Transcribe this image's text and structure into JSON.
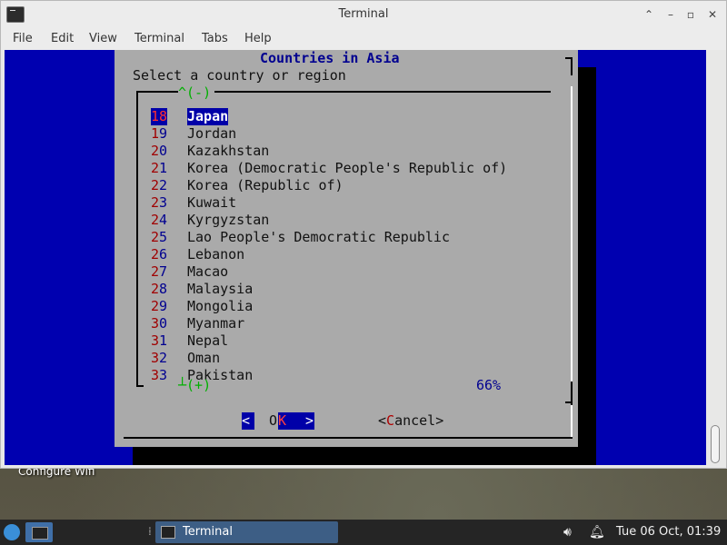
{
  "desktop": {
    "label": "Configure Wifi"
  },
  "window": {
    "title": "Terminal",
    "controls": {
      "up": "⌃",
      "min": "–",
      "max": "▫",
      "close": "✕"
    }
  },
  "menu": [
    "File",
    "Edit",
    "View",
    "Terminal",
    "Tabs",
    "Help"
  ],
  "dialog": {
    "title": "Countries in Asia",
    "prompt": "Select a country or region",
    "scroll_up": "^(-)",
    "scroll_down": "┴(+)",
    "percent": "66%",
    "items": [
      {
        "num1": "1",
        "num2": "8",
        "name": "Japan"
      },
      {
        "num1": "1",
        "num2": "9",
        "name": "Jordan"
      },
      {
        "num1": "2",
        "num2": "0",
        "name": "Kazakhstan"
      },
      {
        "num1": "2",
        "num2": "1",
        "name": "Korea (Democratic People's Republic of)"
      },
      {
        "num1": "2",
        "num2": "2",
        "name": "Korea (Republic of)"
      },
      {
        "num1": "2",
        "num2": "3",
        "name": "Kuwait"
      },
      {
        "num1": "2",
        "num2": "4",
        "name": "Kyrgyzstan"
      },
      {
        "num1": "2",
        "num2": "5",
        "name": "Lao People's Democratic Republic"
      },
      {
        "num1": "2",
        "num2": "6",
        "name": "Lebanon"
      },
      {
        "num1": "2",
        "num2": "7",
        "name": "Macao"
      },
      {
        "num1": "2",
        "num2": "8",
        "name": "Malaysia"
      },
      {
        "num1": "2",
        "num2": "9",
        "name": "Mongolia"
      },
      {
        "num1": "3",
        "num2": "0",
        "name": "Myanmar"
      },
      {
        "num1": "3",
        "num2": "1",
        "name": "Nepal"
      },
      {
        "num1": "3",
        "num2": "2",
        "name": "Oman"
      },
      {
        "num1": "3",
        "num2": "3",
        "name": "Pakistan"
      }
    ],
    "selected_index": 0,
    "ok": {
      "left": "<",
      "o": "O",
      "k": "K",
      "right": ">"
    },
    "cancel": {
      "open": "<",
      "hot": "C",
      "rest": "ancel",
      "close": ">"
    }
  },
  "taskbar": {
    "task_label": "Terminal",
    "clock": "Tue 06 Oct, 01:39"
  },
  "colors": {
    "terminal_bg": "#0000b0",
    "dialog_bg": "#aaaaaa",
    "selection": "#0000a8",
    "accent_green": "#00b000"
  }
}
